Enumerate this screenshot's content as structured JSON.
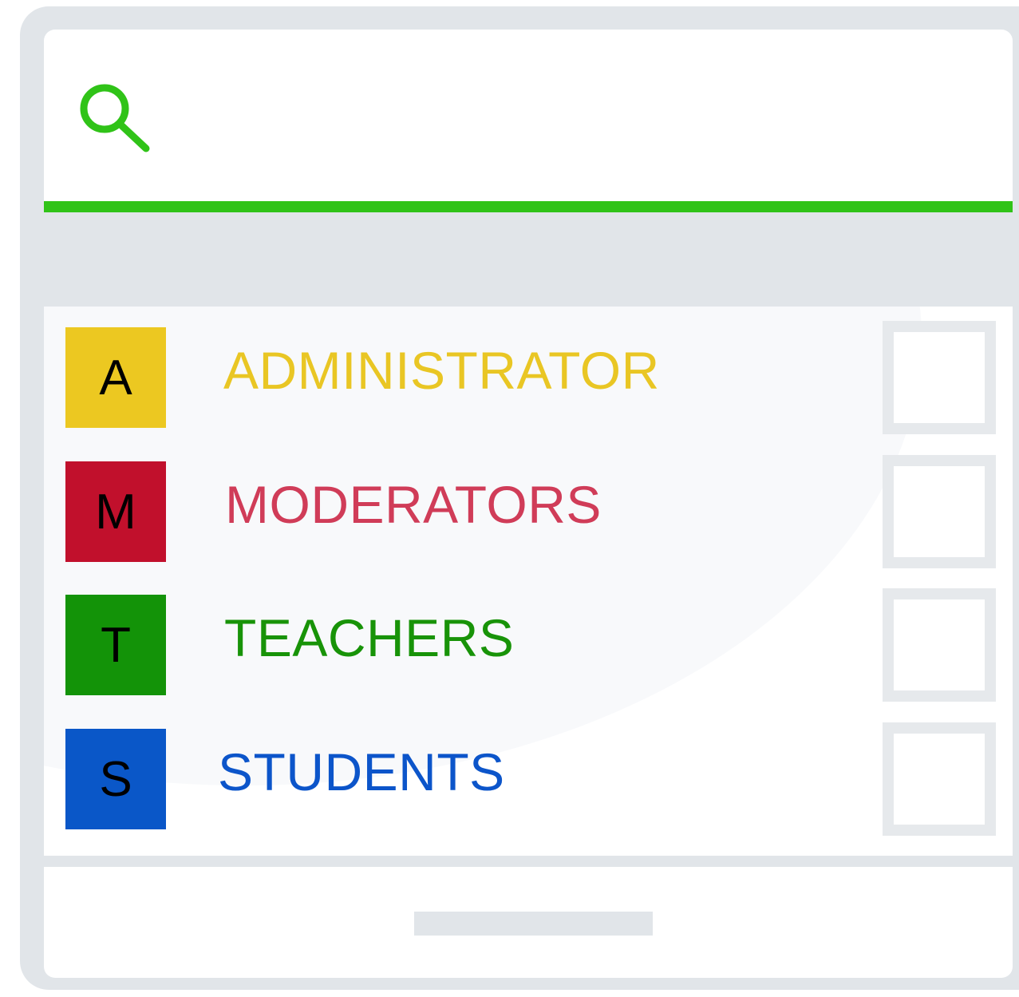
{
  "search": {
    "icon": "search-icon",
    "value": "",
    "placeholder": "",
    "accent_color": "#30c318"
  },
  "roles": [
    {
      "initial": "A",
      "label": "ADMINISTRATOR",
      "badge_color": "#ecc821",
      "label_color": "#e9c624",
      "checked": false
    },
    {
      "initial": "M",
      "label": "MODERATORS",
      "badge_color": "#c1102c",
      "label_color": "#d03c58",
      "checked": false
    },
    {
      "initial": "T",
      "label": "TEACHERS",
      "badge_color": "#139308",
      "label_color": "#189308",
      "checked": false
    },
    {
      "initial": "S",
      "label": "STUDENTS",
      "badge_color": "#0a57c8",
      "label_color": "#0c55ca",
      "checked": false
    }
  ],
  "colors": {
    "frame": "#e1e5e9",
    "checkbox_border": "#e6e9ec"
  }
}
